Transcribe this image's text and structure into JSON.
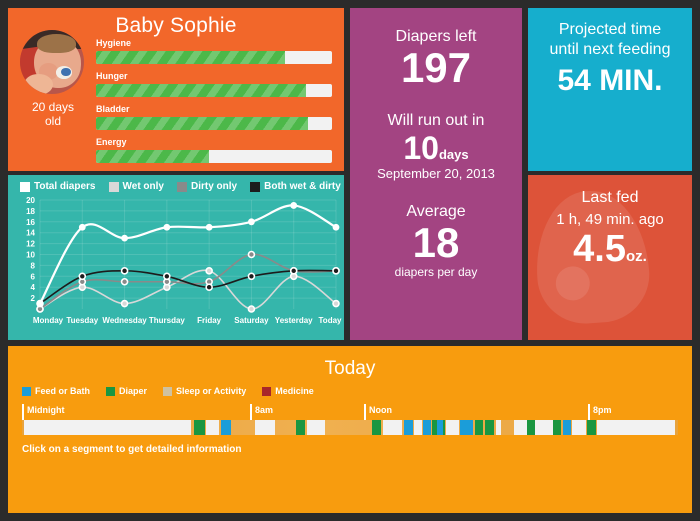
{
  "baby": {
    "name": "Baby Sophie",
    "age": "20 days\nold",
    "age_line1": "20 days",
    "age_line2": "old",
    "photo_alt": "baby-photo",
    "stats": [
      {
        "label": "Hygiene",
        "value": 80
      },
      {
        "label": "Hunger",
        "value": 89
      },
      {
        "label": "Bladder",
        "value": 90
      },
      {
        "label": "Energy",
        "value": 48
      }
    ],
    "bar_fill_color": "#4cb849",
    "bar_track_color": "#f2f2f2",
    "card_color": "#f2672a"
  },
  "diapers": {
    "left_label": "Diapers left",
    "left_value": "197",
    "runout_label": "Will run out in",
    "runout_value": "10",
    "runout_unit": "days",
    "runout_date": "September 20, 2013",
    "average_label": "Average",
    "average_value": "18",
    "average_unit": "diapers per day",
    "card_color": "#a34482"
  },
  "feeding": {
    "label_line1": "Projected time",
    "label_line2": "until next feeding",
    "value": "54 MIN.",
    "card_color": "#16aecd"
  },
  "last_fed": {
    "label": "Last fed",
    "ago": "1 h, 49 min. ago",
    "amount": "4.5",
    "unit": "oz.",
    "icon": "milk-drop-icon",
    "card_color": "#dd5339"
  },
  "chart_data": {
    "type": "line",
    "title": "",
    "xlabel": "",
    "ylabel": "",
    "ylim": [
      0,
      20
    ],
    "yticks": [
      2,
      4,
      6,
      8,
      10,
      12,
      14,
      16,
      18,
      20
    ],
    "grid": true,
    "legend_position": "top",
    "background": "#35b6ab",
    "categories": [
      "Monday",
      "Tuesday",
      "Wednesday",
      "Thursday",
      "Friday",
      "Saturday",
      "Yesterday",
      "Today"
    ],
    "series": [
      {
        "name": "Total diapers",
        "color": "#ffffff",
        "values": [
          1,
          15,
          13,
          15,
          15,
          16,
          19,
          15
        ]
      },
      {
        "name": "Wet only",
        "color": "#d8d8d8",
        "values": [
          0,
          4,
          1,
          4,
          7,
          0,
          6,
          1
        ]
      },
      {
        "name": "Dirty only",
        "color": "#8a8a8a",
        "values": [
          0,
          5,
          5,
          5,
          5,
          10,
          7,
          7
        ]
      },
      {
        "name": "Both wet & dirty",
        "color": "#1c1c1c",
        "values": [
          1,
          6,
          7,
          6,
          4,
          6,
          7,
          7
        ]
      }
    ]
  },
  "today": {
    "title": "Today",
    "hint": "Click on a segment to get detailed information",
    "card_color": "#f89c0e",
    "legend": [
      {
        "label": "Feed or Bath",
        "color": "#1b9dd9"
      },
      {
        "label": "Diaper",
        "color": "#1a9641"
      },
      {
        "label": "Sleep or Activity",
        "color": "#cfc1a0"
      },
      {
        "label": "Medicine",
        "color": "#a8262a"
      }
    ],
    "marks": [
      {
        "label": "Midnight",
        "pos": 0.0
      },
      {
        "label": "8am",
        "pos": 0.3476
      },
      {
        "label": "Noon",
        "pos": 0.5213
      },
      {
        "label": "8pm",
        "pos": 0.8628
      }
    ],
    "segments": [
      {
        "type": "sleep",
        "start": 0.003,
        "width": 0.255,
        "color": "#f2f2f2"
      },
      {
        "type": "diaper",
        "start": 0.262,
        "width": 0.017,
        "color": "#1a9641"
      },
      {
        "type": "sleep",
        "start": 0.281,
        "width": 0.02,
        "color": "#f2f2f2"
      },
      {
        "type": "feed",
        "start": 0.304,
        "width": 0.015,
        "color": "#1b9dd9"
      },
      {
        "type": "diaper",
        "start": 0.63,
        "width": 0.015,
        "color": "#1a9641"
      },
      {
        "type": "sleep",
        "start": 0.647,
        "width": 0.019,
        "color": "#f2f2f2"
      },
      {
        "type": "feed",
        "start": 0.668,
        "width": 0.019,
        "color": "#1b9dd9"
      },
      {
        "type": "diaper",
        "start": 0.69,
        "width": 0.013,
        "color": "#1a9641"
      },
      {
        "type": "diaper",
        "start": 0.706,
        "width": 0.013,
        "color": "#1a9641"
      },
      {
        "type": "sleep",
        "start": 0.722,
        "width": 0.008,
        "color": "#f2f2f2"
      },
      {
        "type": "sleep",
        "start": 0.775,
        "width": 0.034,
        "color": "#f2f2f2"
      },
      {
        "type": "diaper",
        "start": 0.893,
        "width": 0.015,
        "color": "#1a9641"
      },
      {
        "type": "sleep",
        "start": 0.91,
        "width": 0.03,
        "color": "#f2f2f2"
      },
      {
        "type": "sleep",
        "start": 1.06,
        "width": 0.04,
        "color": "#f2f2f2"
      }
    ],
    "segments_full": [
      {
        "type": "sleep",
        "start": 0.003,
        "width": 0.255,
        "color": "#f2f2f2"
      },
      {
        "type": "diaper",
        "start": 0.262,
        "width": 0.017,
        "color": "#1a9641"
      },
      {
        "type": "sleep",
        "start": 0.283,
        "width": 0.019,
        "color": "#f2f2f2"
      },
      {
        "type": "feed",
        "start": 0.306,
        "width": 0.014,
        "color": "#1b9dd9"
      },
      {
        "type": "diaper",
        "start": 0.63,
        "width": 0.014,
        "color": "#1a9641"
      },
      {
        "type": "sleep",
        "start": 0.647,
        "width": 0.018,
        "color": "#f2f2f2"
      },
      {
        "type": "feed",
        "start": 0.668,
        "width": 0.018,
        "color": "#1b9dd9"
      },
      {
        "type": "diaper",
        "start": 0.689,
        "width": 0.012,
        "color": "#1a9641"
      },
      {
        "type": "diaper",
        "start": 0.705,
        "width": 0.012,
        "color": "#1a9641"
      },
      {
        "type": "sleep",
        "start": 0.721,
        "width": 0.007,
        "color": "#f2f2f2"
      }
    ]
  }
}
